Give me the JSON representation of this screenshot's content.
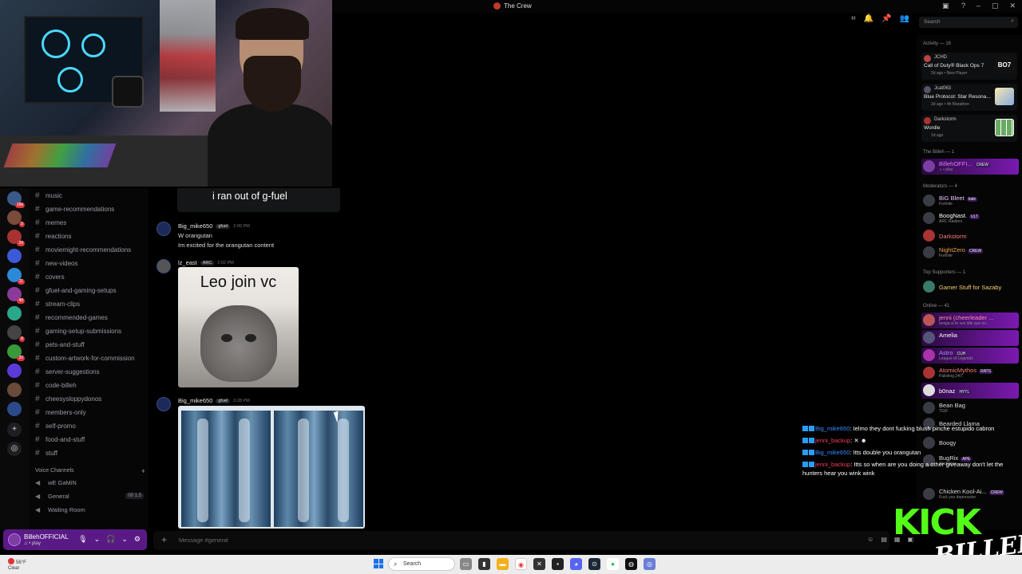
{
  "window": {
    "title": "The Crew"
  },
  "servers": [
    {
      "badge": "16k"
    },
    {
      "badge": "5"
    },
    {
      "badge": "29"
    },
    {
      "badge": ""
    },
    {
      "badge": "11"
    },
    {
      "badge": "48"
    },
    {
      "badge": ""
    },
    {
      "badge": "8"
    },
    {
      "badge": "20"
    },
    {
      "badge": ""
    },
    {
      "badge": ""
    },
    {
      "badge": ""
    }
  ],
  "channels": [
    "music",
    "game-recommendations",
    "memes",
    "reactions",
    "moviemight-recommendations",
    "new-videos",
    "covers",
    "gfuel-and-gaming-setups",
    "stream-clips",
    "recommended-games",
    "gaming-setup-submissions",
    "pets-and-stuff",
    "custom-artwork-for-commission",
    "server-suggestions",
    "code-billeh",
    "cheesysloppydonos",
    "members-only",
    "self-promo",
    "food-and-stuff",
    "stuff"
  ],
  "voice": {
    "header": "Voice Channels",
    "channels": [
      {
        "name": "wE GaMiN",
        "count": ""
      },
      {
        "name": "General",
        "count": "00  1.5"
      },
      {
        "name": "Waiting Room",
        "count": ""
      }
    ]
  },
  "user_panel": {
    "name": "BillehOFFICIAL",
    "status": "♫ • play"
  },
  "messages": {
    "caption_text": "i ran out of g-fuel",
    "msg1": {
      "author": "Big_mike650",
      "tag": "gfuel",
      "time": "2:00 PM",
      "lines": [
        "W orangutan",
        "Im excited for the orangutan content"
      ]
    },
    "msg2": {
      "author": "lz_east",
      "tag": "ARC",
      "time": "2:02 PM",
      "image_caption": "Leo join vc"
    },
    "msg3": {
      "author": "Big_mike650",
      "tag": "gfuel",
      "time": "3:28 PM"
    }
  },
  "composer": {
    "placeholder": "Message #general"
  },
  "search": {
    "placeholder": "Search"
  },
  "activity": {
    "header": "Activity — 16",
    "cards": [
      {
        "user": "JCHD",
        "game": "Call of Duty® Black Ops 7",
        "meta": "2d ago  •  New Player",
        "art": "BO7"
      },
      {
        "user": "Jcat063",
        "game": "Blue Protocol: Star Resona...",
        "meta": "2d ago  •  4h Marathon",
        "art": ""
      },
      {
        "user": "Darkstorm",
        "game": "Wordle",
        "meta": "1d ago",
        "art": ""
      }
    ]
  },
  "member_groups": [
    {
      "header": "The Billeh — 1",
      "members": [
        {
          "name": "BillehOFFI...",
          "tag": "CREW",
          "sub": "♫ • play",
          "color": "#e07bff",
          "highlight": true
        }
      ]
    },
    {
      "header": "Moderators — 4",
      "members": [
        {
          "name": "BiG Bleet",
          "tag": "kate",
          "sub": "Fortnite",
          "color": "#f0c0ff",
          "highlight": false
        },
        {
          "name": "BoogNast.",
          "tag": "ULT",
          "sub": "ARC Raiders",
          "color": "#ffffff",
          "highlight": false
        },
        {
          "name": "Darkstorm",
          "tag": "",
          "sub": "",
          "color": "#ff7b7b",
          "highlight": false
        },
        {
          "name": "NightZero",
          "tag": "CREW",
          "sub": "Fortnite",
          "color": "#f0a050",
          "highlight": false
        }
      ]
    },
    {
      "header": "Top Supporters — 1",
      "members": [
        {
          "name": "Gamer Stuff for Sazaby",
          "tag": "",
          "sub": "",
          "color": "#f5d06a",
          "highlight": false
        }
      ]
    },
    {
      "header": "Online — 41",
      "members": [
        {
          "name": "jenni (cheerleader ...",
          "tag": "",
          "sub": "amiga si te ves dile que so...",
          "color": "#ff8bb5",
          "highlight": true
        },
        {
          "name": "Amelia",
          "tag": "",
          "sub": "",
          "color": "#ffffff",
          "highlight": true
        },
        {
          "name": "Astro",
          "tag": "CUH",
          "sub": "League of Legends",
          "color": "#b28bff",
          "highlight": true
        },
        {
          "name": "AtomicMythos",
          "tag": "RATS",
          "sub": "Palisting 24/7",
          "color": "#ff7b7b",
          "highlight": false
        },
        {
          "name": "b0naz",
          "tag": "HYTL",
          "sub": "",
          "color": "#ffffff",
          "highlight": true
        },
        {
          "name": "Bean Bag",
          "tag": "",
          "sub": "TGIF",
          "color": "#dddddd",
          "highlight": false
        },
        {
          "name": "Bearded Llama",
          "tag": "",
          "sub": "",
          "color": "#dddddd",
          "highlight": false
        },
        {
          "name": "Boogy",
          "tag": "",
          "sub": "",
          "color": "#dddddd",
          "highlight": false
        },
        {
          "name": "BugRix",
          "tag": "APE",
          "sub": "Warframe",
          "color": "#dddddd",
          "highlight": false
        },
        {
          "name": "Chicken Kool-Ai...",
          "tag": "CREW",
          "sub": "Fuck you depression",
          "color": "#dddddd",
          "highlight": false
        }
      ]
    }
  ],
  "chat_overlay": [
    {
      "user": "Big_mike650",
      "user_color": "blue",
      "text": ": Ielmo they dont fucking blush pinche estupido cabron"
    },
    {
      "user": "jenni_backup",
      "user_color": "red",
      "text": ": ✕ ☻"
    },
    {
      "user": "Big_mike650",
      "user_color": "blue",
      "text": ": Itts double you orangutan"
    },
    {
      "user": "jenni_backup",
      "user_color": "red",
      "text": ": Itts so when are you doing a other giveaway don't let the hunters hear you wink wink"
    }
  ],
  "kick": {
    "logo_text": "KICK",
    "name_text": "BILLEH"
  },
  "taskbar": {
    "temp": "56°F",
    "condition": "Clear",
    "search": "Search"
  }
}
